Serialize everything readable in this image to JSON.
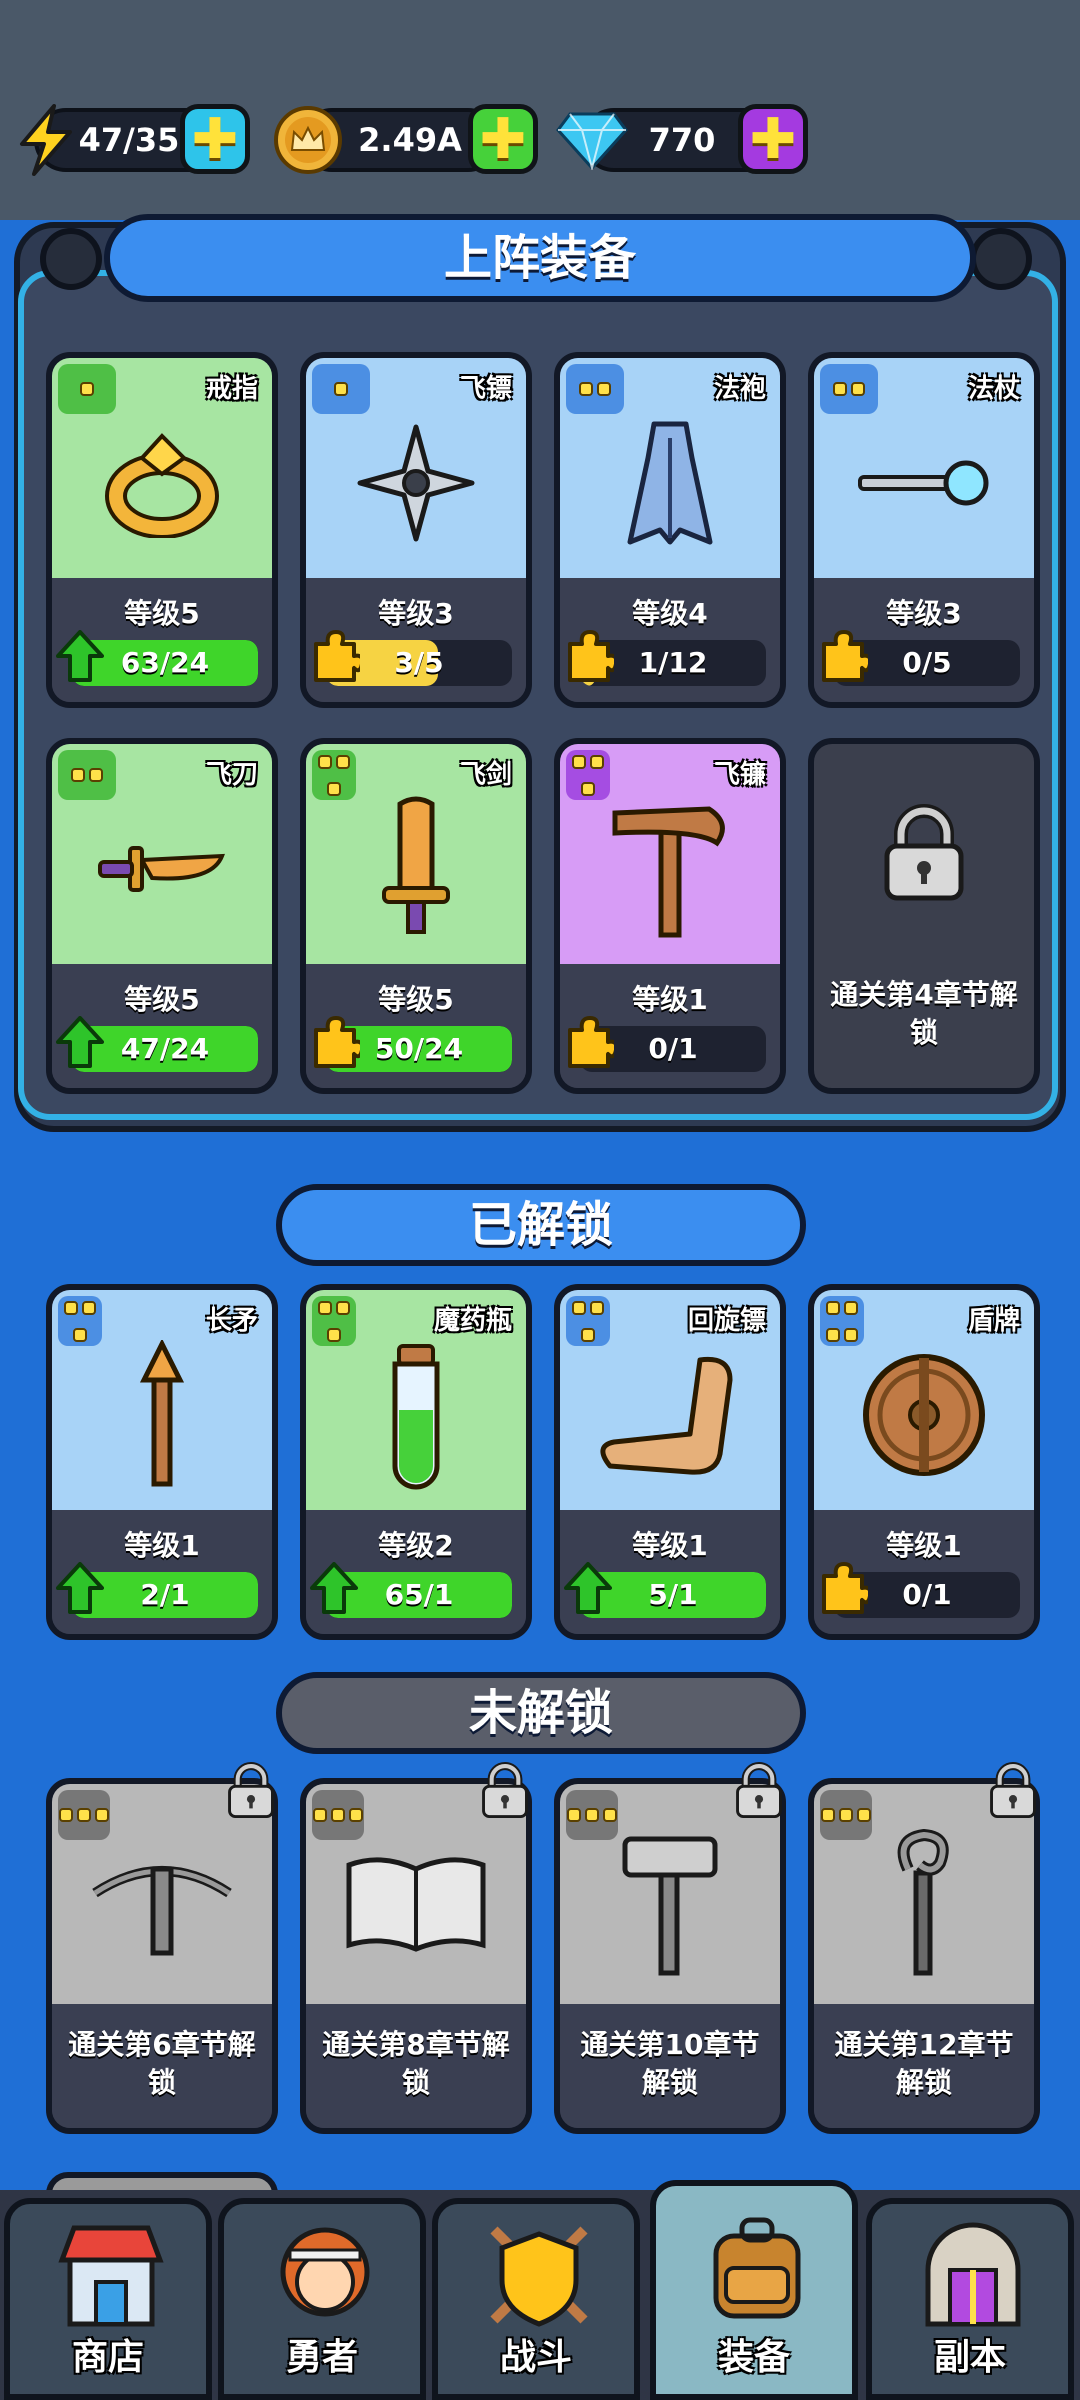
{
  "resources": {
    "energy": {
      "value": "47/35",
      "icon": "lightning-icon"
    },
    "gold": {
      "value": "2.49A",
      "icon": "crown-coin-icon"
    },
    "gems": {
      "value": "770",
      "icon": "diamond-icon"
    }
  },
  "equipped": {
    "title": "上阵装备",
    "cards": [
      {
        "name": "戒指",
        "level": "等级5",
        "progress": "63/24",
        "rarity": "green",
        "tier": 1,
        "fill": 1.0,
        "upgradable": true,
        "icon": "ring-icon"
      },
      {
        "name": "飞镖",
        "level": "等级3",
        "progress": "3/5",
        "rarity": "blue",
        "tier": 1,
        "fill": 0.6,
        "upgradable": false,
        "icon": "shuriken-icon"
      },
      {
        "name": "法袍",
        "level": "等级4",
        "progress": "1/12",
        "rarity": "blue",
        "tier": 2,
        "fill": 0.08,
        "upgradable": false,
        "icon": "robe-icon"
      },
      {
        "name": "法杖",
        "level": "等级3",
        "progress": "0/5",
        "rarity": "blue",
        "tier": 2,
        "fill": 0,
        "upgradable": false,
        "icon": "wand-icon"
      },
      {
        "name": "飞刀",
        "level": "等级5",
        "progress": "47/24",
        "rarity": "green",
        "tier": 2,
        "fill": 1.0,
        "upgradable": true,
        "icon": "knife-icon"
      },
      {
        "name": "飞剑",
        "level": "等级5",
        "progress": "50/24",
        "rarity": "green",
        "tier": 3,
        "fill": 1.0,
        "upgradable": false,
        "icon": "sword-icon"
      },
      {
        "name": "飞镰",
        "level": "等级1",
        "progress": "0/1",
        "rarity": "purple",
        "tier": 3,
        "fill": 0,
        "upgradable": false,
        "icon": "scythe-icon"
      }
    ],
    "locked_slot": {
      "text": "通关第4章节解锁",
      "icon": "padlock-icon"
    }
  },
  "unlocked": {
    "title": "已解锁",
    "cards": [
      {
        "name": "长矛",
        "level": "等级1",
        "progress": "2/1",
        "rarity": "blue",
        "tier": 3,
        "fill": 1.0,
        "upgradable": true,
        "icon": "spear-icon"
      },
      {
        "name": "魔药瓶",
        "level": "等级2",
        "progress": "65/1",
        "rarity": "green",
        "tier": 3,
        "fill": 1.0,
        "upgradable": true,
        "icon": "potion-icon"
      },
      {
        "name": "回旋镖",
        "level": "等级1",
        "progress": "5/1",
        "rarity": "blue",
        "tier": 3,
        "fill": 1.0,
        "upgradable": true,
        "icon": "boomerang-icon"
      },
      {
        "name": "盾牌",
        "level": "等级1",
        "progress": "0/1",
        "rarity": "blue",
        "tier": 4,
        "fill": 0,
        "upgradable": false,
        "icon": "shield-icon"
      }
    ]
  },
  "locked": {
    "title": "未解锁",
    "cards": [
      {
        "text": "通关第6章节解锁",
        "icon": "crossbow-icon"
      },
      {
        "text": "通关第8章节解锁",
        "icon": "book-icon"
      },
      {
        "text": "通关第10章节解锁",
        "icon": "hammer-icon"
      },
      {
        "text": "通关第12章节解锁",
        "icon": "staff-icon"
      }
    ]
  },
  "nav": {
    "tabs": [
      {
        "label": "商店",
        "icon": "shop-icon",
        "active": false
      },
      {
        "label": "勇者",
        "icon": "hero-icon",
        "active": false
      },
      {
        "label": "战斗",
        "icon": "battle-shield-icon",
        "active": false
      },
      {
        "label": "装备",
        "icon": "backpack-icon",
        "active": true
      },
      {
        "label": "副本",
        "icon": "dungeon-gate-icon",
        "active": false
      }
    ]
  },
  "colors": {
    "accent_blue": "#1f6fd6",
    "panel": "#3b4861",
    "bar_green": "#3fd52a",
    "bar_yellow": "#f6d343"
  }
}
